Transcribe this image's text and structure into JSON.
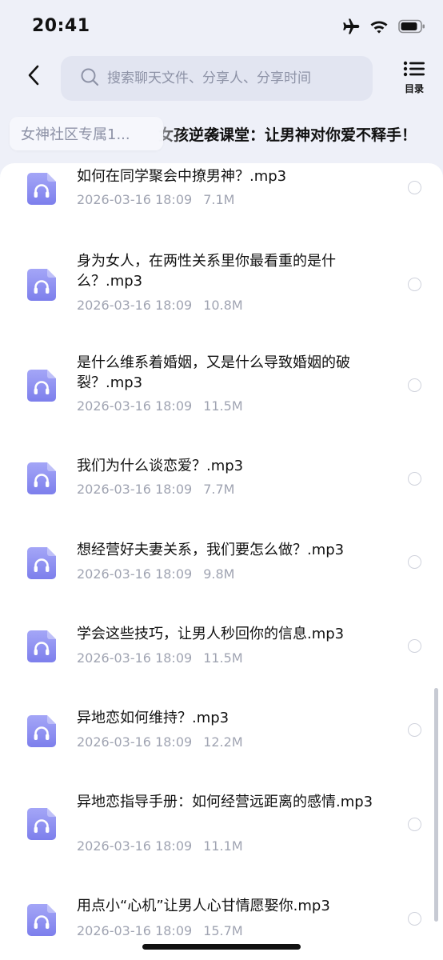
{
  "status_bar": {
    "time": "20:41"
  },
  "search": {
    "placeholder": "搜索聊天文件、分享人、分享时间"
  },
  "catalog": {
    "label": "目录"
  },
  "header": {
    "group_chip": "女神社区专属1...",
    "marquee": "女孩逆袭课堂：让男神对你爱不释手！"
  },
  "files": [
    {
      "name": "如何在同学聚会中撩男神？.mp3",
      "date": "2026-03-16 18:09",
      "size": "7.1M"
    },
    {
      "name": "身为女人，在两性关系里你最看重的是什么？.mp3",
      "date": "2026-03-16 18:09",
      "size": "10.8M"
    },
    {
      "name": "是什么维系着婚姻，又是什么导致婚姻的破裂？.mp3",
      "date": "2026-03-16 18:09",
      "size": "11.5M"
    },
    {
      "name": "我们为什么谈恋爱？.mp3",
      "date": "2026-03-16 18:09",
      "size": "7.7M"
    },
    {
      "name": "想经营好夫妻关系，我们要怎么做？.mp3",
      "date": "2026-03-16 18:09",
      "size": "9.8M"
    },
    {
      "name": "学会这些技巧，让男人秒回你的信息.mp3",
      "date": "2026-03-16 18:09",
      "size": "11.5M"
    },
    {
      "name": "异地恋如何维持？.mp3",
      "date": "2026-03-16 18:09",
      "size": "12.2M"
    },
    {
      "name": "异地恋指导手册：如何经营远距离的感情.mp3",
      "date": "2026-03-16 18:09",
      "size": "11.1M"
    },
    {
      "name": "用点小“心机”让男人心甘情愿娶你.mp3",
      "date": "2026-03-16 18:09",
      "size": "15.7M"
    }
  ],
  "icons": {
    "file": "audio-file-icon",
    "back": "chevron-left-icon",
    "search": "search-icon",
    "catalog": "list-icon"
  },
  "colors": {
    "icon_gradient_top": "#a4a6f7",
    "icon_gradient_bottom": "#7d7fec"
  }
}
